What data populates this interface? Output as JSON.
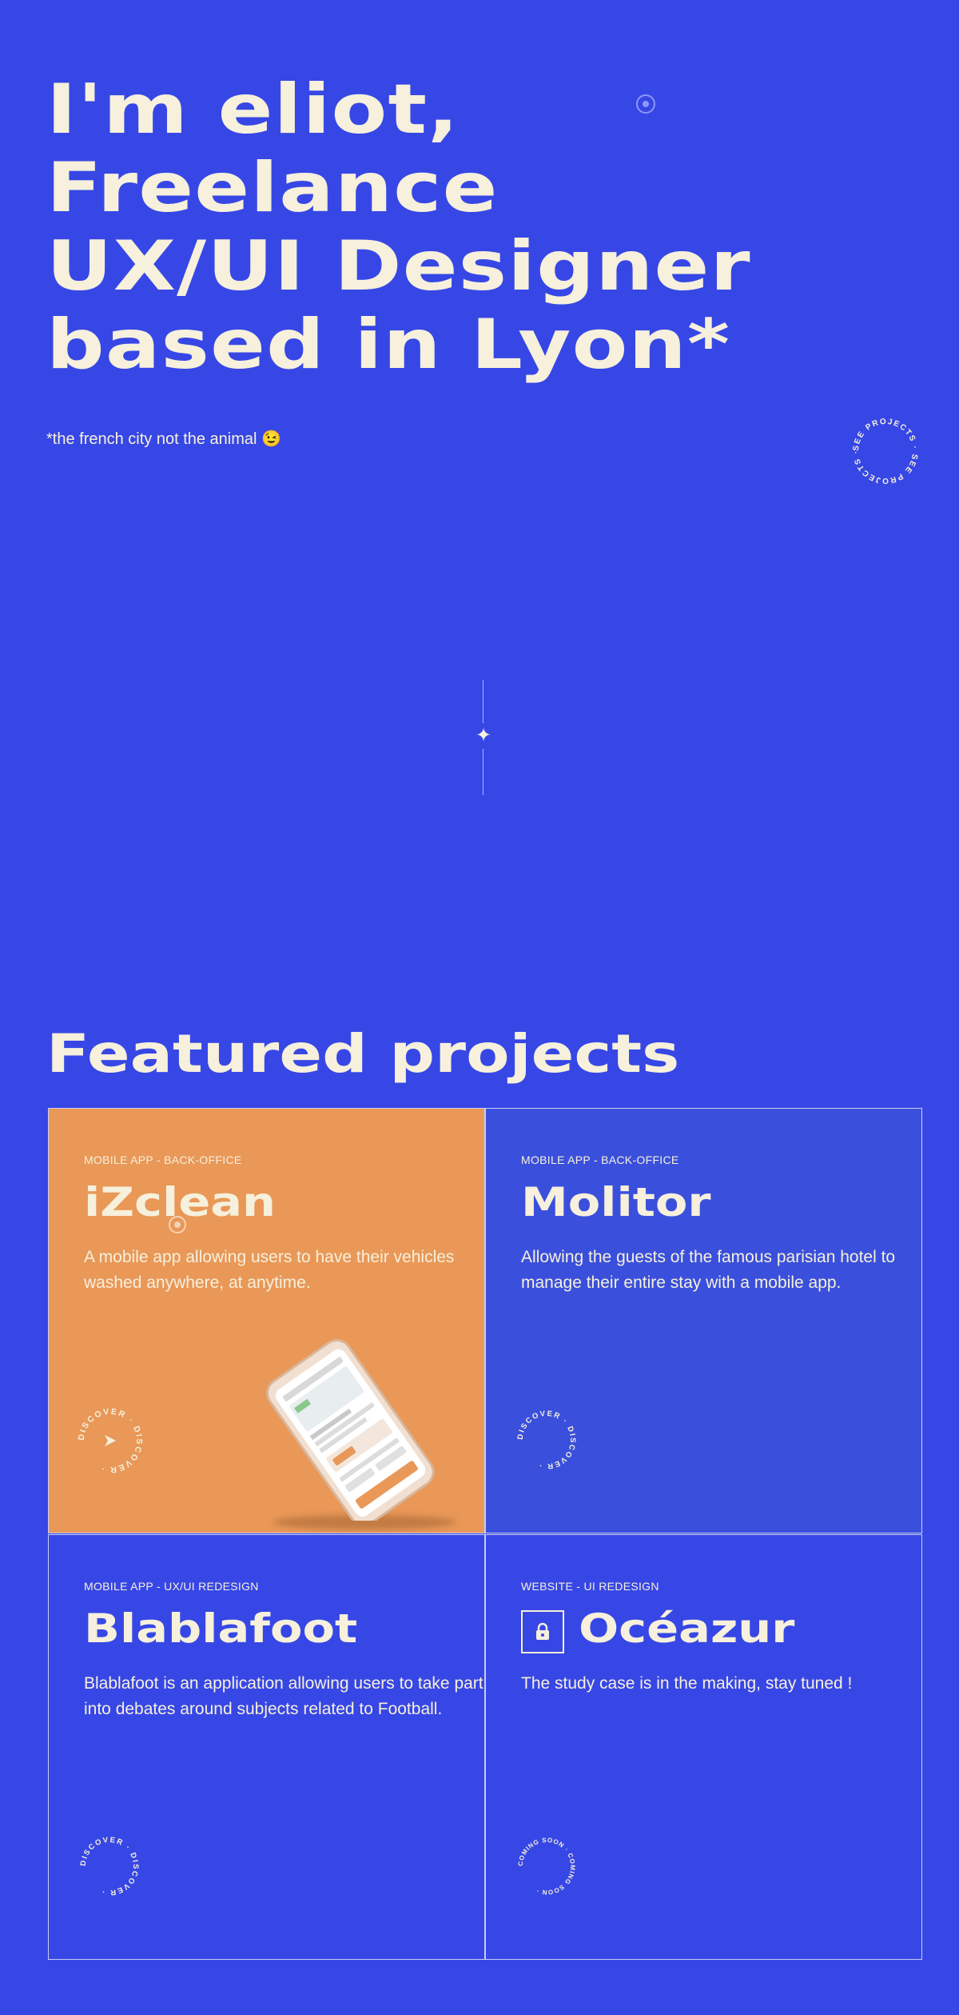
{
  "hero": {
    "title": "I'm eliot,\nFreelance\nUX/UI Designer\nbased in Lyon*",
    "note": "*the french city not the animal 😉",
    "badge_text": "SEE PROJECTS · SEE PROJECTS · "
  },
  "projects": {
    "title": "Featured projects",
    "items": [
      {
        "tag": "MOBILE APP - BACK-OFFICE",
        "name": "iZclean",
        "description": "A mobile app allowing users to have their vehicles washed anywhere, at anytime.",
        "badge_text": "DISCOVER · DISCOVER · "
      },
      {
        "tag": "MOBILE APP - BACK-OFFICE",
        "name": "Molitor",
        "description": "Allowing the guests of the famous parisian hotel to manage their entire stay with a mobile app.",
        "badge_text": "DISCOVER · DISCOVER · "
      },
      {
        "tag": "MOBILE APP - UX/UI REDESIGN",
        "name": "Blablafoot",
        "description": "Blablafoot is an application allowing users to take part into debates around subjects related to Football.",
        "badge_text": "DISCOVER · DISCOVER · "
      },
      {
        "tag": "WEBSITE - UI REDESIGN",
        "name": "Océazur",
        "description": "The study case is in the making, stay tuned !",
        "badge_text": "COMING SOON · COMING SOON · "
      }
    ]
  },
  "colors": {
    "background": "#3747e5",
    "cream": "#f6f0dc",
    "orange": "#e99858"
  },
  "icons": {
    "divider": "sparkle-icon",
    "lock": "lock-icon",
    "arrow": "arrow-icon"
  }
}
